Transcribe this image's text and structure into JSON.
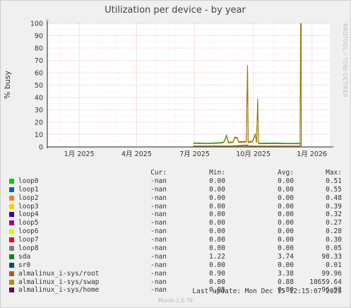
{
  "chart_data": {
    "type": "line",
    "title": "Utilization per device - by year",
    "ylabel": "% busy",
    "side_label": "RRDTOOL / TOBI OETIKER",
    "ylim": [
      0,
      100
    ],
    "yticks": [
      0,
      10,
      20,
      30,
      40,
      50,
      60,
      70,
      80,
      90,
      100
    ],
    "xrange": [
      "2024-11-12",
      "2026-01-29"
    ],
    "xticks": [
      {
        "date": "2025-01-01",
        "label": "1月 2025"
      },
      {
        "date": "2025-04-01",
        "label": "4月 2025"
      },
      {
        "date": "2025-07-01",
        "label": "7月 2025"
      },
      {
        "date": "2025-10-01",
        "label": "10月 2025"
      },
      {
        "date": "2026-01-01",
        "label": "1月 2026"
      }
    ],
    "now_marker": "2025-12-15",
    "series": [
      {
        "name": "sda",
        "color": "#00a000",
        "points": [
          [
            "2025-06-29",
            3.3
          ],
          [
            "2025-07-20",
            3.0
          ],
          [
            "2025-08-10",
            3.5
          ],
          [
            "2025-08-16",
            4.0
          ],
          [
            "2025-08-20",
            9.5
          ],
          [
            "2025-08-23",
            3.8
          ],
          [
            "2025-08-30",
            4.0
          ],
          [
            "2025-09-02",
            8.0
          ],
          [
            "2025-09-06",
            7.5
          ],
          [
            "2025-09-08",
            4.2
          ],
          [
            "2025-09-20",
            4.5
          ],
          [
            "2025-09-22",
            66.0
          ],
          [
            "2025-09-23",
            4.0
          ],
          [
            "2025-09-30",
            4.8
          ],
          [
            "2025-10-04",
            10.5
          ],
          [
            "2025-10-06",
            4.0
          ],
          [
            "2025-10-08",
            39.0
          ],
          [
            "2025-10-09",
            3.0
          ],
          [
            "2025-11-01",
            3.2
          ],
          [
            "2025-11-20",
            3.0
          ],
          [
            "2025-12-14",
            3.0
          ]
        ]
      },
      {
        "name": "almalinux_i-sys/root",
        "color": "#b07000",
        "points": [
          [
            "2025-06-29",
            2.8
          ],
          [
            "2025-07-20",
            2.6
          ],
          [
            "2025-08-10",
            3.0
          ],
          [
            "2025-08-16",
            3.5
          ],
          [
            "2025-08-20",
            8.8
          ],
          [
            "2025-08-23",
            3.2
          ],
          [
            "2025-08-30",
            3.5
          ],
          [
            "2025-09-02",
            7.3
          ],
          [
            "2025-09-06",
            6.8
          ],
          [
            "2025-09-08",
            3.6
          ],
          [
            "2025-09-20",
            3.9
          ],
          [
            "2025-09-22",
            65.0
          ],
          [
            "2025-09-23",
            3.4
          ],
          [
            "2025-09-30",
            4.2
          ],
          [
            "2025-10-04",
            9.8
          ],
          [
            "2025-10-06",
            3.4
          ],
          [
            "2025-10-08",
            38.0
          ],
          [
            "2025-10-09",
            2.5
          ],
          [
            "2025-11-01",
            2.7
          ],
          [
            "2025-11-20",
            2.5
          ],
          [
            "2025-12-14",
            2.5
          ]
        ]
      },
      {
        "name": "almalinux_i-sys/home",
        "color": "#800080",
        "points": [
          [
            "2025-06-29",
            0.8
          ],
          [
            "2025-09-01",
            0.9
          ],
          [
            "2025-09-22",
            1.5
          ],
          [
            "2025-09-23",
            0.8
          ],
          [
            "2025-12-14",
            0.8
          ]
        ]
      },
      {
        "name": "almalinux_i-sys/swap",
        "color": "#b09000",
        "points": [
          [
            "2025-06-29",
            0.6
          ],
          [
            "2025-12-13",
            0.7
          ],
          [
            "2025-12-14",
            100
          ],
          [
            "2025-12-15",
            0.6
          ]
        ]
      }
    ]
  },
  "legend": {
    "headers": {
      "cur": "Cur:",
      "min": "Min:",
      "avg": "Avg:",
      "max": "Max:"
    },
    "rows": [
      {
        "name": "loop0",
        "color": "#00cc00",
        "cur": "-nan",
        "min": "0.00",
        "avg": "0.00",
        "max": "0.51"
      },
      {
        "name": "loop1",
        "color": "#0066b3",
        "cur": "-nan",
        "min": "0.00",
        "avg": "0.00",
        "max": "0.55"
      },
      {
        "name": "loop2",
        "color": "#ff8000",
        "cur": "-nan",
        "min": "0.00",
        "avg": "0.00",
        "max": "0.48"
      },
      {
        "name": "loop3",
        "color": "#ffcc00",
        "cur": "-nan",
        "min": "0.00",
        "avg": "0.00",
        "max": "0.39"
      },
      {
        "name": "loop4",
        "color": "#330099",
        "cur": "-nan",
        "min": "0.00",
        "avg": "0.00",
        "max": "0.32"
      },
      {
        "name": "loop5",
        "color": "#990099",
        "cur": "-nan",
        "min": "0.00",
        "avg": "0.00",
        "max": "0.27"
      },
      {
        "name": "loop6",
        "color": "#ccff00",
        "cur": "-nan",
        "min": "0.00",
        "avg": "0.00",
        "max": "0.28"
      },
      {
        "name": "loop7",
        "color": "#ff0000",
        "cur": "-nan",
        "min": "0.00",
        "avg": "0.00",
        "max": "0.30"
      },
      {
        "name": "loop8",
        "color": "#808080",
        "cur": "-nan",
        "min": "0.00",
        "avg": "0.00",
        "max": "0.05"
      },
      {
        "name": "sda",
        "color": "#008f00",
        "cur": "-nan",
        "min": "1.22",
        "avg": "3.74",
        "max": "98.33"
      },
      {
        "name": "sr0",
        "color": "#00487d",
        "cur": "-nan",
        "min": "0.00",
        "avg": "0.00",
        "max": "0.01"
      },
      {
        "name": "almalinux_i-sys/root",
        "color": "#b35a00",
        "cur": "-nan",
        "min": "0.90",
        "avg": "3.38",
        "max": "99.96"
      },
      {
        "name": "almalinux_i-sys/swap",
        "color": "#b38f00",
        "cur": "-nan",
        "min": "0.00",
        "avg": "0.88",
        "max": "18659.64"
      },
      {
        "name": "almalinux_i-sys/home",
        "color": "#6b006b",
        "cur": "-nan",
        "min": "0.05",
        "avg": "0.80",
        "max": "96.92"
      }
    ]
  },
  "footer": {
    "last_update": "Last update: Mon Dec 15 12:15:07 2025",
    "munin": "Munin 2.0.76"
  }
}
